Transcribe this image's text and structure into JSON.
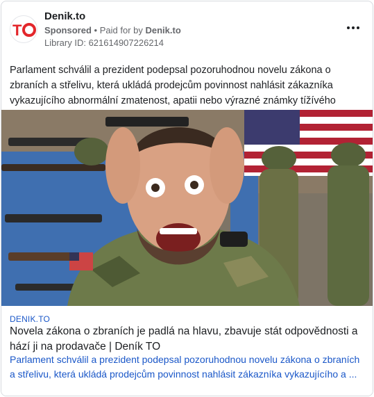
{
  "header": {
    "page_name": "Denik.to",
    "sponsored": "Sponsored",
    "separator": "•",
    "paid_for_by": "Paid for by",
    "paid_for_by_name": "Denik.to",
    "library_id": "Library ID: 621614907226214"
  },
  "post": {
    "text": "Parlament schválil a prezident podepsal pozoruhodnou novelu zákona o zbraních a střelivu, která ukládá prodejcům povinnost nahlásit zákazníka vykazujícího abnormální zmatenost, apatii nebo výrazné známky tížívého stresu."
  },
  "link": {
    "domain": "DENIK.TO",
    "headline": "Novela zákona o zbraních je padlá na hlavu, zbavuje stát odpovědnosti a hází ji na prodavače | Deník TO",
    "description": "Parlament schválil a prezident podepsal pozoruhodnou novelu zákona o zbraních a střelivu, která ukládá prodejcům povinnost nahlásit zákazníka vykazujícího a ..."
  },
  "colors": {
    "brand_red": "#e3262b",
    "link_blue": "#1a57c8",
    "meta_gray": "#65676b"
  },
  "icons": {
    "logo": "denik-to-logo",
    "more": "more-options-icon"
  }
}
